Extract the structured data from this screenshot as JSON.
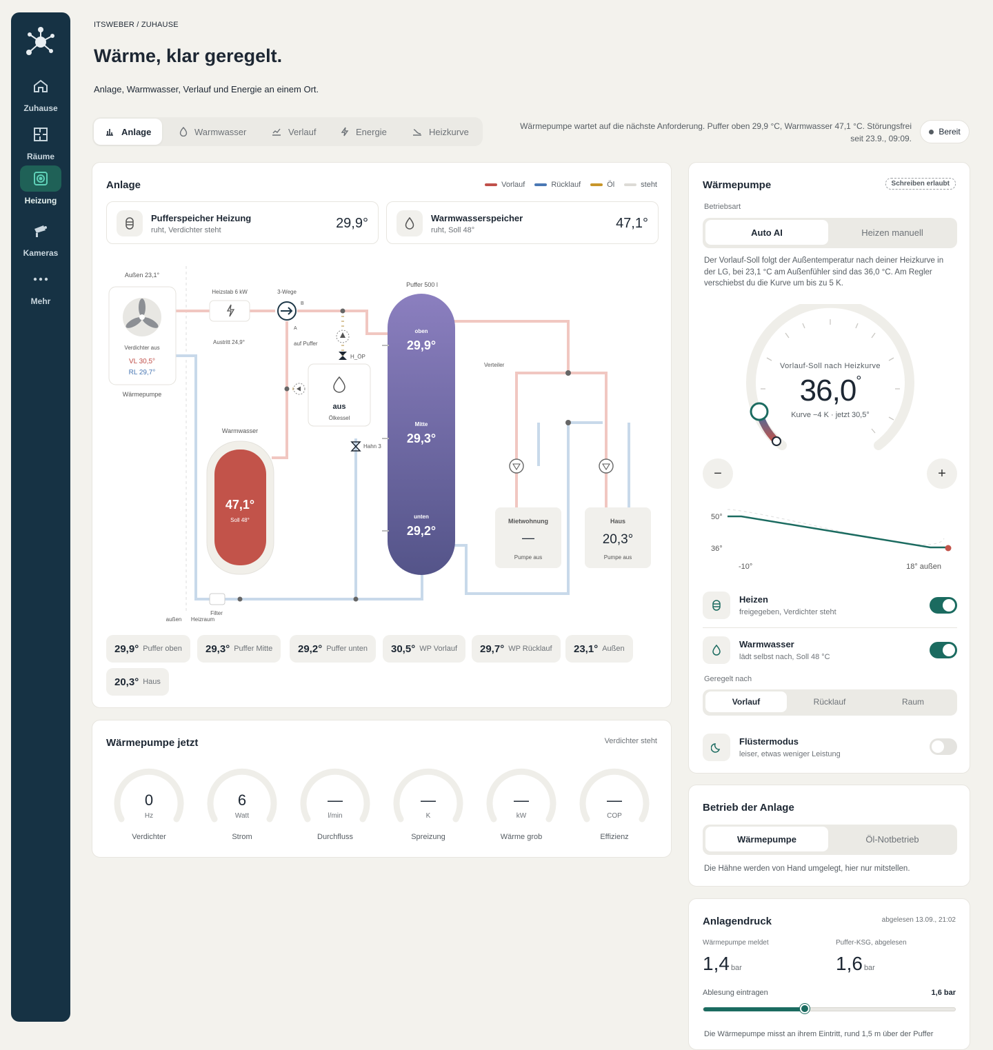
{
  "sidebar": {
    "items": [
      {
        "label": "Zuhause",
        "icon": "home-icon"
      },
      {
        "label": "Räume",
        "icon": "floorplan-icon"
      },
      {
        "label": "Heizung",
        "icon": "heating-icon",
        "active": true
      },
      {
        "label": "Kameras",
        "icon": "camera-icon"
      },
      {
        "label": "Mehr",
        "icon": "more-icon"
      }
    ]
  },
  "header": {
    "breadcrumb": "ITSWEBER / ZUHAUSE",
    "title": "Wärme, klar geregelt.",
    "subtitle": "Anlage, Warmwasser, Verlauf und Energie an einem Ort."
  },
  "tabs": [
    {
      "label": "Anlage",
      "icon": "bar-chart-icon"
    },
    {
      "label": "Warmwasser",
      "icon": "drop-icon"
    },
    {
      "label": "Verlauf",
      "icon": "line-chart-icon"
    },
    {
      "label": "Energie",
      "icon": "bolt-icon"
    },
    {
      "label": "Heizkurve",
      "icon": "curve-icon"
    }
  ],
  "status": {
    "line1": "Wärmepumpe wartet auf die nächste Anforderung. Puffer oben 29,9 °C, Warmwasser 47,1 °C. Störungsfrei",
    "line2": "seit 23.9., 09:09.",
    "badge": "Bereit"
  },
  "anlage": {
    "title": "Anlage",
    "legend": [
      {
        "label": "Vorlauf",
        "color": "#c0504a"
      },
      {
        "label": "Rücklauf",
        "color": "#4a78b4"
      },
      {
        "label": "Öl",
        "color": "#c8962a"
      },
      {
        "label": "steht",
        "color": "#dddbd6"
      }
    ],
    "storage": [
      {
        "title": "Pufferspeicher Heizung",
        "sub": "ruht, Verdichter steht",
        "value": "29,9°"
      },
      {
        "title": "Warmwasserspeicher",
        "sub": "ruht, Soll 48°",
        "value": "47,1°"
      }
    ],
    "schema": {
      "aussen": "Außen 23,1°",
      "heizstab": "Heizstab 6 kW",
      "dreiwege": "3-Wege",
      "b": "B",
      "a": "A",
      "austritt": "Austritt 24,9°",
      "auf_puffer": "auf Puffer",
      "hoep": "H_ÖP",
      "verdichter": "Verdichter aus",
      "vl": "VL 30,5°",
      "rl": "RL 29,7°",
      "wp_label": "Wärmepumpe",
      "oel_state": "aus",
      "oel_label": "Ölkessel",
      "hahn3": "Hahn 3",
      "ww_label": "Warmwasser",
      "ww_value": "47,1°",
      "ww_soll": "Soll 48°",
      "puffer_label": "Puffer 500 l",
      "oben": "oben",
      "oben_val": "29,9°",
      "mitte": "Mitte",
      "mitte_val": "29,3°",
      "unten": "unten",
      "unten_val": "29,2°",
      "verteiler": "Verteiler",
      "mietwohnung": "Mietwohnung",
      "mietwohnung_val": "—",
      "mietwohnung_pumpe": "Pumpe aus",
      "haus": "Haus",
      "haus_val": "20,3°",
      "haus_pumpe": "Pumpe aus",
      "filter": "Filter",
      "aussen_bottom": "außen",
      "heizraum": "Heizraum"
    },
    "chips": [
      {
        "value": "29,9°",
        "label": "Puffer oben"
      },
      {
        "value": "29,3°",
        "label": "Puffer Mitte"
      },
      {
        "value": "29,2°",
        "label": "Puffer unten"
      },
      {
        "value": "30,5°",
        "label": "WP Vorlauf"
      },
      {
        "value": "29,7°",
        "label": "WP Rücklauf"
      },
      {
        "value": "23,1°",
        "label": "Außen"
      },
      {
        "value": "20,3°",
        "label": "Haus"
      }
    ]
  },
  "wp_now": {
    "title": "Wärmepumpe jetzt",
    "state": "Verdichter steht",
    "gauges": [
      {
        "value": "0",
        "unit": "Hz",
        "label": "Verdichter"
      },
      {
        "value": "6",
        "unit": "Watt",
        "label": "Strom"
      },
      {
        "value": "—",
        "unit": "l/min",
        "label": "Durchfluss"
      },
      {
        "value": "—",
        "unit": "K",
        "label": "Spreizung"
      },
      {
        "value": "—",
        "unit": "kW",
        "label": "Wärme grob"
      },
      {
        "value": "—",
        "unit": "COP",
        "label": "Effizienz"
      }
    ]
  },
  "waermepumpe": {
    "title": "Wärmepumpe",
    "badge": "Schreiben erlaubt",
    "betriebsart_label": "Betriebsart",
    "modes": [
      "Auto AI",
      "Heizen manuell"
    ],
    "description": "Der Vorlauf-Soll folgt der Außentemperatur nach deiner Heizkurve in der LG, bei 23,1 °C am Außenfühler sind das 36,0 °C. Am Regler verschiebst du die Kurve um bis zu 5 K.",
    "dial_label": "Vorlauf-Soll nach Heizkurve",
    "dial_value": "36,0",
    "dial_deg": "°",
    "dial_sub": "Kurve −4 K · jetzt 30,5°",
    "minus": "−",
    "plus": "+",
    "curve": {
      "y_top": "50°",
      "y_bottom": "36°",
      "x_left": "-10°",
      "x_right": "18° außen"
    },
    "switches": [
      {
        "title": "Heizen",
        "sub": "freigegeben, Verdichter steht",
        "on": true
      },
      {
        "title": "Warmwasser",
        "sub": "lädt selbst nach, Soll 48 °C",
        "on": true
      }
    ],
    "geregelt_label": "Geregelt nach",
    "geregelt": [
      "Vorlauf",
      "Rücklauf",
      "Raum"
    ],
    "fluester": {
      "title": "Flüstermodus",
      "sub": "leiser, etwas weniger Leistung",
      "on": false
    }
  },
  "betrieb": {
    "title": "Betrieb der Anlage",
    "options": [
      "Wärmepumpe",
      "Öl-Notbetrieb"
    ],
    "note": "Die Hähne werden von Hand umgelegt, hier nur mitstellen."
  },
  "druck": {
    "title": "Anlagendruck",
    "read": "abgelesen 13.09., 21:02",
    "wp_label": "Wärmepumpe meldet",
    "wp_value": "1,4",
    "puffer_label": "Puffer-KSG, abgelesen",
    "puffer_value": "1,6",
    "unit": "bar",
    "entry_label": "Ablesung eintragen",
    "entry_value": "1,6 bar",
    "slider_fraction": 0.4,
    "footer": "Die Wärmepumpe misst an ihrem Eintritt, rund 1,5 m über der Puffer"
  }
}
